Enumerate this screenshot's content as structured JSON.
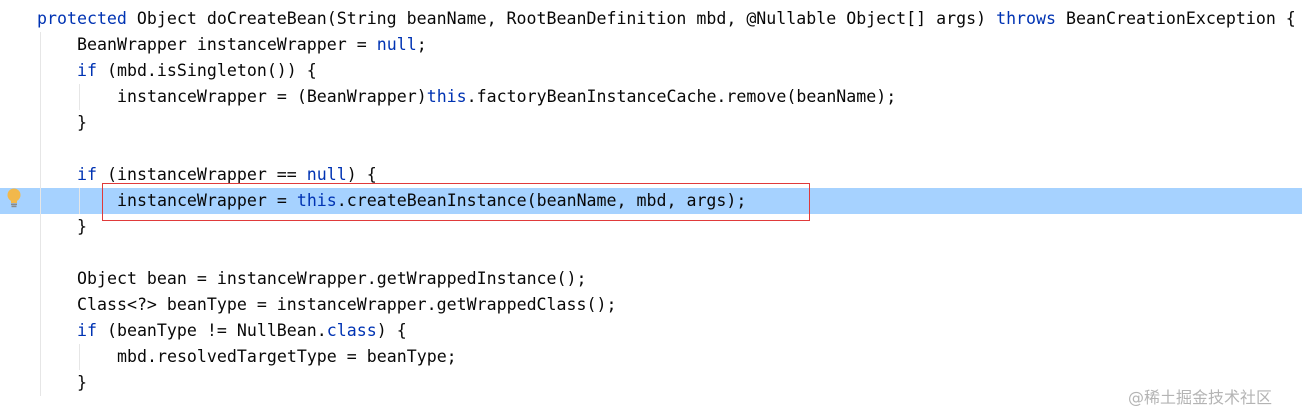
{
  "editor": {
    "lines": [
      {
        "indent": 0,
        "tokens": [
          {
            "t": "protected",
            "kw": true
          },
          {
            "t": " Object doCreateBean(String beanName, RootBeanDefinition mbd, @Nullable Object[] args) "
          },
          {
            "t": "throws",
            "kw": true
          },
          {
            "t": " BeanCreationException {"
          }
        ]
      },
      {
        "indent": 1,
        "tokens": [
          {
            "t": "BeanWrapper instanceWrapper = "
          },
          {
            "t": "null",
            "kw": true
          },
          {
            "t": ";"
          }
        ]
      },
      {
        "indent": 1,
        "tokens": [
          {
            "t": "if",
            "kw": true
          },
          {
            "t": " (mbd.isSingleton()) {"
          }
        ]
      },
      {
        "indent": 2,
        "tokens": [
          {
            "t": "instanceWrapper = (BeanWrapper)"
          },
          {
            "t": "this",
            "kw": true
          },
          {
            "t": ".factoryBeanInstanceCache.remove(beanName);"
          }
        ]
      },
      {
        "indent": 1,
        "tokens": [
          {
            "t": "}"
          }
        ]
      },
      {
        "indent": 1,
        "tokens": []
      },
      {
        "indent": 1,
        "tokens": [
          {
            "t": "if",
            "kw": true
          },
          {
            "t": " (instanceWrapper == "
          },
          {
            "t": "null",
            "kw": true
          },
          {
            "t": ") {"
          }
        ]
      },
      {
        "indent": 2,
        "current": true,
        "tokens": [
          {
            "t": "instanceWrapper = "
          },
          {
            "t": "this",
            "kw": true
          },
          {
            "t": ".createBeanInstance(beanName, mbd, args);"
          }
        ]
      },
      {
        "indent": 1,
        "tokens": [
          {
            "t": "}"
          }
        ]
      },
      {
        "indent": 1,
        "tokens": []
      },
      {
        "indent": 1,
        "tokens": [
          {
            "t": "Object bean = instanceWrapper.getWrappedInstance();"
          }
        ]
      },
      {
        "indent": 1,
        "tokens": [
          {
            "t": "Class<?> beanType = instanceWrapper.getWrappedClass();"
          }
        ]
      },
      {
        "indent": 1,
        "tokens": [
          {
            "t": "if",
            "kw": true
          },
          {
            "t": " (beanType != NullBean."
          },
          {
            "t": "class",
            "kw": true
          },
          {
            "t": ") {"
          }
        ]
      },
      {
        "indent": 2,
        "tokens": [
          {
            "t": "mbd.resolvedTargetType = beanType;"
          }
        ]
      },
      {
        "indent": 1,
        "tokens": [
          {
            "t": "}"
          }
        ]
      }
    ]
  },
  "gutter": {
    "icon": "lightbulb-icon"
  },
  "colors": {
    "keyword": "#0033b3",
    "text": "#080808",
    "current_line": "#a6d2ff",
    "highlight_box": "#e03a3a",
    "bulb": "#f2b84b"
  },
  "watermark": "@稀土掘金技术社区"
}
